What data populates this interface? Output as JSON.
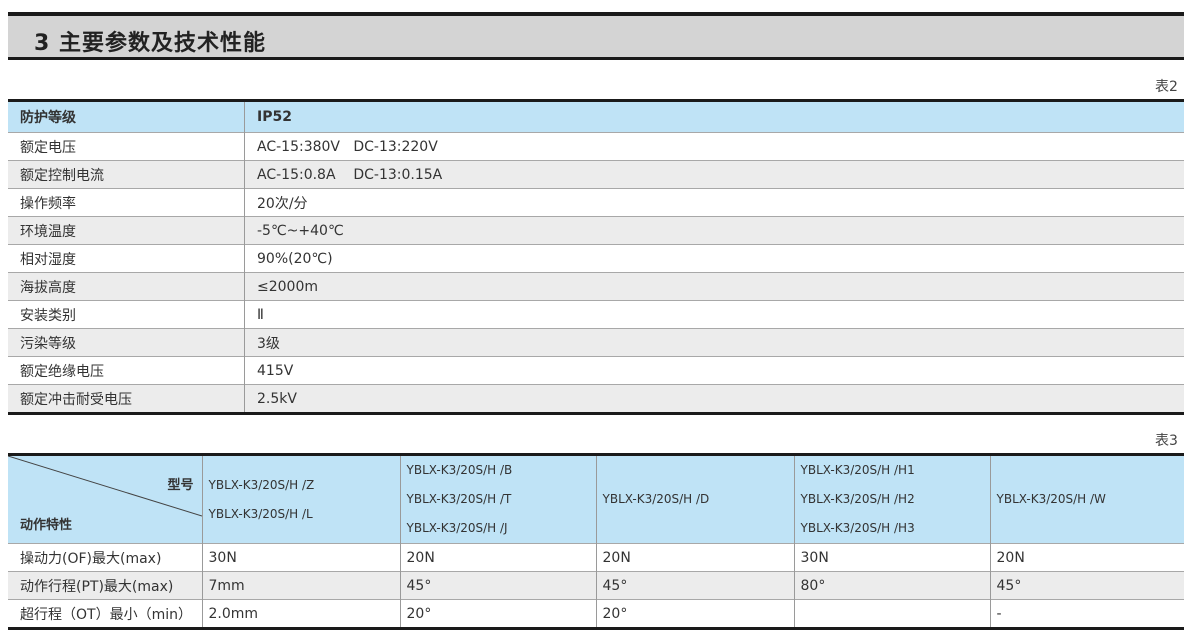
{
  "header": {
    "title": "3 主要参数及技术性能"
  },
  "table2": {
    "label": "表2",
    "rows": [
      {
        "name": "防护等级",
        "value": "IP52"
      },
      {
        "name": "额定电压",
        "value": "AC-15:380V   DC-13:220V"
      },
      {
        "name": "额定控制电流",
        "value": "AC-15:0.8A    DC-13:0.15A"
      },
      {
        "name": "操作频率",
        "value": "20次/分"
      },
      {
        "name": "环境温度",
        "value": "-5℃~+40℃"
      },
      {
        "name": "相对湿度",
        "value": "90%(20℃)"
      },
      {
        "name": "海拔高度",
        "value": "≤2000m"
      },
      {
        "name": "安装类别",
        "value": "Ⅱ"
      },
      {
        "name": "污染等级",
        "value": "3级"
      },
      {
        "name": "额定绝缘电压",
        "value": "415V"
      },
      {
        "name": "额定冲击耐受电压",
        "value": "2.5kV"
      }
    ]
  },
  "table3": {
    "label": "表3",
    "corner_top": "型号",
    "corner_bottom": "动作特性",
    "models": [
      [
        "YBLX-K3/20S/H /Z",
        "YBLX-K3/20S/H /L"
      ],
      [
        "YBLX-K3/20S/H /B",
        "YBLX-K3/20S/H /T",
        "YBLX-K3/20S/H /J"
      ],
      [
        "YBLX-K3/20S/H /D"
      ],
      [
        "YBLX-K3/20S/H /H1",
        "YBLX-K3/20S/H /H2",
        "YBLX-K3/20S/H /H3"
      ],
      [
        "YBLX-K3/20S/H /W"
      ]
    ],
    "rows": [
      {
        "name": "操动力(OF)最大(max)",
        "values": [
          "30N",
          "20N",
          "20N",
          "30N",
          "20N"
        ]
      },
      {
        "name": "动作行程(PT)最大(max)",
        "values": [
          "7mm",
          "45°",
          "45°",
          "80°",
          "45°"
        ]
      },
      {
        "name": "超行程（OT）最小（min）",
        "values": [
          "2.0mm",
          "20°",
          "20°",
          "",
          "-"
        ]
      }
    ]
  }
}
